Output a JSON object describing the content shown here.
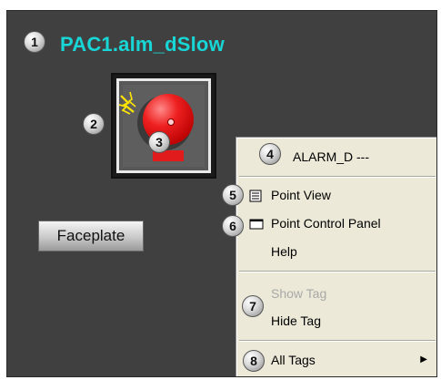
{
  "tag_title": "PAC1.alm_dSlow",
  "faceplate_label": "Faceplate",
  "badges": [
    "1",
    "2",
    "3",
    "4",
    "5",
    "6",
    "7",
    "8"
  ],
  "menu": {
    "header": "ALARM_D ---",
    "items": {
      "point_view": "Point View",
      "point_control_panel": "Point Control Panel",
      "help": "Help",
      "show_tag": "Show Tag",
      "hide_tag": "Hide Tag",
      "all_tags": "All Tags"
    },
    "submenu_arrow": "▶"
  },
  "colors": {
    "background": "#404040",
    "title": "#19d6d6",
    "alarm_bell": "#ee2020",
    "menu_bg": "#ece9d8",
    "disabled_text": "#a8a8a8"
  },
  "icons": {
    "alarm": "alarm-bell-icon",
    "point_view": "point-view-icon",
    "point_control_panel": "control-panel-icon"
  }
}
